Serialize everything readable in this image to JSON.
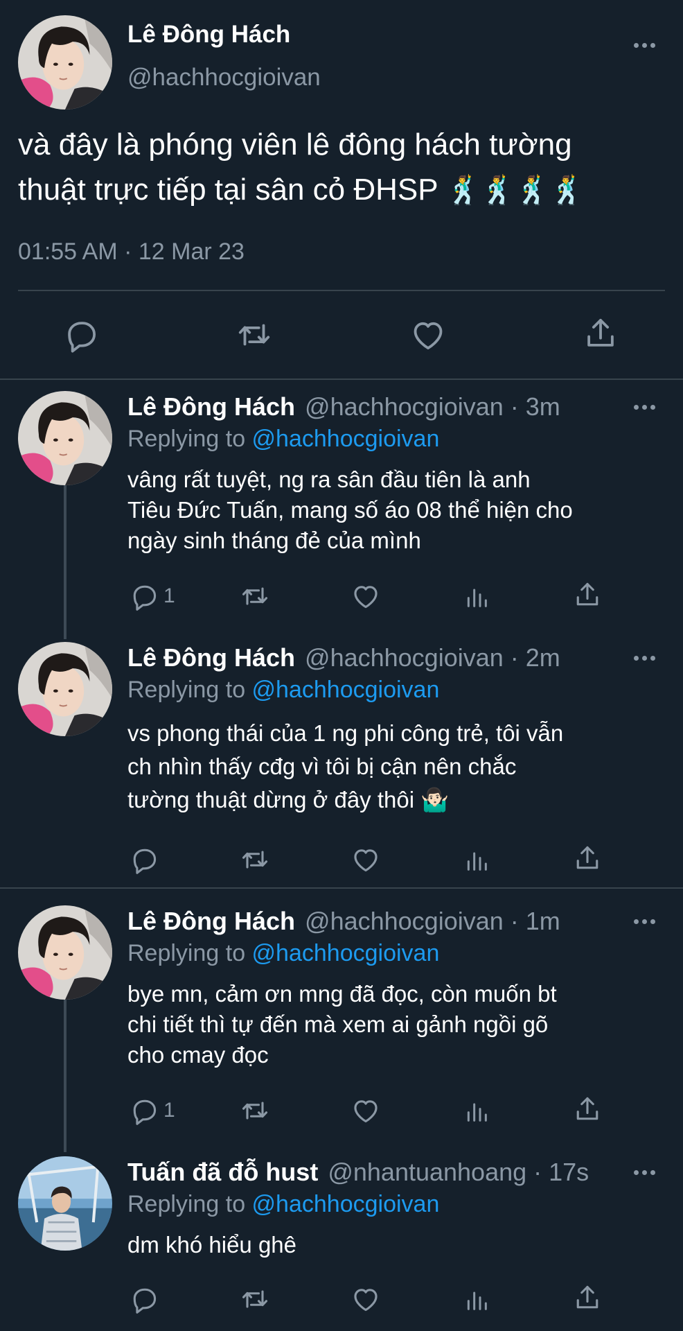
{
  "main_tweet": {
    "display_name": "Lê Đông Hách",
    "handle": "@hachhocgioivan",
    "text_line1": "và đây là phóng viên lê đông hách tường",
    "text_line2": "thuật trực tiếp tại sân cỏ ĐHSP",
    "emojis": "🕺🕺🕺🕺",
    "timestamp": "01:55 AM · 12 Mar 23"
  },
  "replies": [
    {
      "display_name": "Lê Đông Hách",
      "meta": "@hachhocgioivan · 3m",
      "replying_prefix": "Replying to ",
      "replying_handle": "@hachhocgioivan",
      "text": "vâng rất tuyệt, ng ra sân đầu tiên là anh\nTiêu Đức Tuấn, mang số áo 08 thể hiện cho\nngày sinh tháng đẻ của mình",
      "reply_count": "1"
    },
    {
      "display_name": "Lê Đông Hách",
      "meta": "@hachhocgioivan · 2m",
      "replying_prefix": "Replying to ",
      "replying_handle": "@hachhocgioivan",
      "text": "vs phong thái của 1 ng phi công trẻ, tôi vẫn\nch nhìn thấy cđg vì tôi bị cận nên chắc\ntường thuật dừng ở đây thôi 🤷🏻‍♂️",
      "reply_count": ""
    },
    {
      "display_name": "Lê Đông Hách",
      "meta": "@hachhocgioivan · 1m",
      "replying_prefix": "Replying to ",
      "replying_handle": "@hachhocgioivan",
      "text": "bye mn, cảm ơn mng đã đọc, còn muốn bt\nchi tiết thì tự đến mà xem ai gảnh ngồi gõ\ncho cmay đọc",
      "reply_count": "1"
    },
    {
      "display_name": "Tuấn đã đỗ hust",
      "meta": "@nhantuanhoang · 17s",
      "replying_prefix": "Replying to ",
      "replying_handle": "@hachhocgioivan",
      "text": "dm khó hiểu ghê",
      "reply_count": ""
    }
  ],
  "colors": {
    "background": "#15202b",
    "text": "#ffffff",
    "muted": "#8b98a5",
    "link": "#1d9bf0",
    "separator": "#38444d"
  },
  "icons": [
    "reply-icon",
    "retweet-icon",
    "like-icon",
    "share-icon",
    "analytics-icon",
    "more-icon"
  ]
}
